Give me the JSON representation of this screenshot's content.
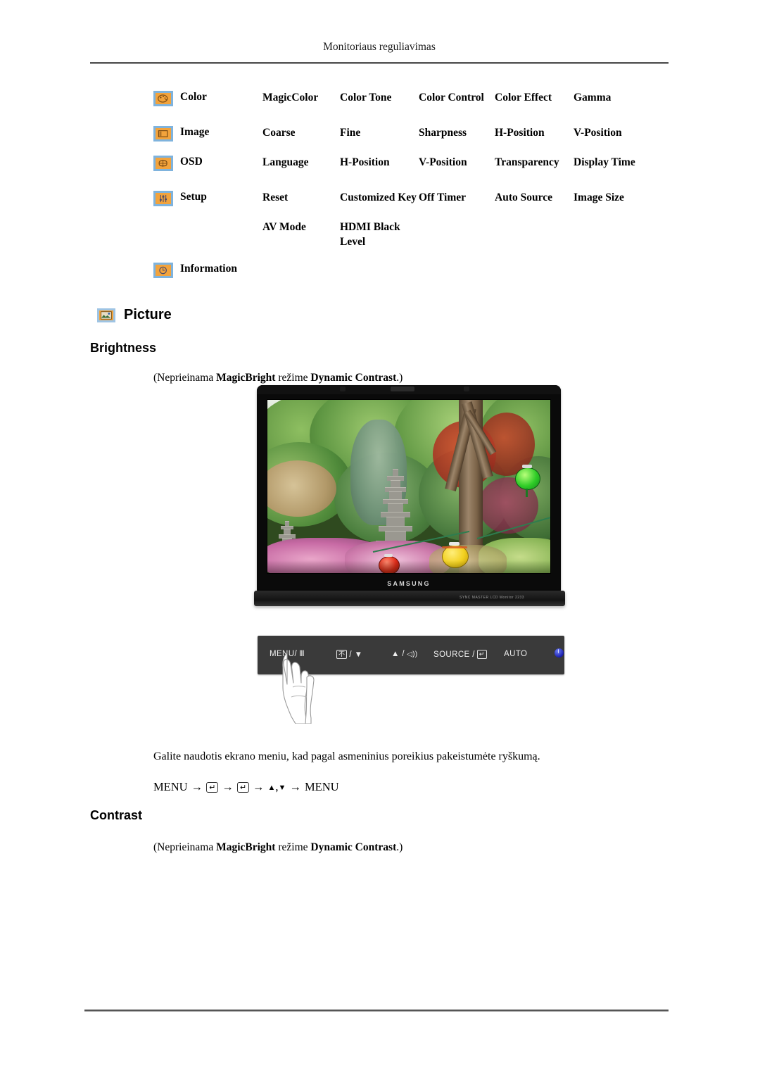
{
  "header": {
    "running_title": "Monitoriaus reguliavimas"
  },
  "osd_menu": {
    "rows": [
      {
        "icon": "color-palette-icon",
        "category": "Color",
        "items": [
          "MagicColor",
          "Color Tone",
          "Color Control",
          "Color Effect",
          "Gamma"
        ]
      },
      {
        "icon": "image-frame-icon",
        "category": "Image",
        "items": [
          "Coarse",
          "Fine",
          "Sharpness",
          "H-Position",
          "V-Position"
        ]
      },
      {
        "icon": "osd-box-icon",
        "category": "OSD",
        "items": [
          "Language",
          "H-Position",
          "V-Position",
          "Transparency",
          "Display Time"
        ]
      },
      {
        "icon": "setup-sliders-icon",
        "category": "Setup",
        "items": [
          "Reset",
          "Customized Key",
          "Off Timer",
          "Auto Source",
          "Image Size"
        ]
      },
      {
        "icon": "",
        "category": "",
        "items": [
          "AV Mode",
          "HDMI Black Level",
          "",
          "",
          ""
        ]
      },
      {
        "icon": "information-clock-icon",
        "category": "Information",
        "items": [
          "",
          "",
          "",
          "",
          ""
        ]
      }
    ]
  },
  "picture_section": {
    "icon": "picture-icon",
    "title": "Picture",
    "brightness": {
      "heading": "Brightness",
      "note_prefix": "(Neprieinama ",
      "note_bold1": "MagicBright",
      "note_mid": " režime ",
      "note_bold2": "Dynamic Contrast",
      "note_suffix": ".)",
      "usage_text": "Galite naudotis ekrano meniu, kad pagal asmeninius poreikius pakeistumėte ryškumą.",
      "menu_path": {
        "start": "MENU",
        "enter_key": "↵",
        "up_triangle": "▲",
        "down_triangle": "▼",
        "comma": ",",
        "arrow": "→",
        "end": "MENU"
      }
    },
    "contrast": {
      "heading": "Contrast",
      "note_prefix": "(Neprieinama ",
      "note_bold1": "MagicBright",
      "note_mid": " režime ",
      "note_bold2": "Dynamic Contrast",
      "note_suffix": ".)"
    }
  },
  "monitor": {
    "brand": "SAMSUNG",
    "base_micro_text": "SYNC  MASTER  LCD  Monitor  2233",
    "control_panel": {
      "buttons": [
        {
          "label": "MENU/",
          "icon": "exit-icon",
          "icon_glyph": "III"
        },
        {
          "label": "",
          "icon": "magic-bright-icon",
          "icon_glyph": "不",
          "suffix": "/ ▼"
        },
        {
          "label": "",
          "icon": "volume-icon",
          "prefix": "▲ /",
          "icon_glyph": "◁))"
        },
        {
          "label": "SOURCE /",
          "icon": "enter-icon",
          "icon_glyph": "↵"
        },
        {
          "label": "AUTO",
          "icon": ""
        },
        {
          "label": "",
          "icon": "power-icon"
        }
      ]
    }
  },
  "colors": {
    "icon_fill": "#f2a33c",
    "icon_border": "#7fb3dd",
    "panel_bg": "#3a3a3a",
    "power_blue": "#1b1fae",
    "rule": "#555555"
  }
}
